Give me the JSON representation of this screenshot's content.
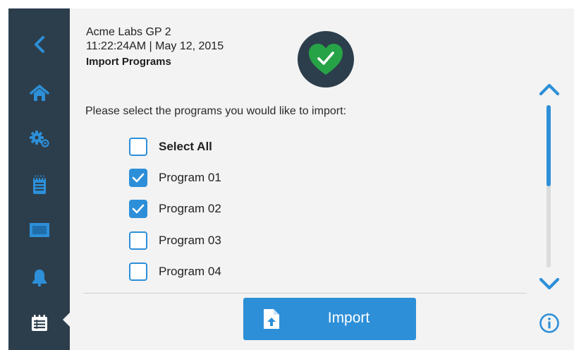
{
  "header": {
    "device_name": "Acme Labs GP 2",
    "clock": "11:22:24AM | May 12, 2015",
    "title": "Import Programs",
    "status_icon": "heart-check-icon"
  },
  "sidebar": {
    "items": [
      {
        "name": "back",
        "icon": "chevron-left-icon"
      },
      {
        "name": "home",
        "icon": "home-icon"
      },
      {
        "name": "settings",
        "icon": "gears-icon"
      },
      {
        "name": "notes",
        "icon": "notepad-icon"
      },
      {
        "name": "display",
        "icon": "monitor-icon"
      },
      {
        "name": "alerts",
        "icon": "bell-icon"
      },
      {
        "name": "programs",
        "icon": "program-list-icon",
        "active": true
      }
    ]
  },
  "content": {
    "instruction": "Please select the programs you would like to import:",
    "select_all": {
      "label": "Select All",
      "checked": false
    },
    "programs": [
      {
        "label": "Program 01",
        "checked": true
      },
      {
        "label": "Program 02",
        "checked": true
      },
      {
        "label": "Program 03",
        "checked": false
      },
      {
        "label": "Program 04",
        "checked": false
      }
    ]
  },
  "actions": {
    "import_label": "Import",
    "import_icon": "file-upload-icon"
  },
  "scroll": {
    "up_icon": "chevron-up-icon",
    "down_icon": "chevron-down-icon",
    "info_icon": "info-icon",
    "position": 0,
    "visible_fraction": 0.5
  },
  "colors": {
    "sidebar": "#2c3e4c",
    "accent": "#2d8fd8",
    "status_ok": "#27a347",
    "background": "#f3f3f3"
  }
}
